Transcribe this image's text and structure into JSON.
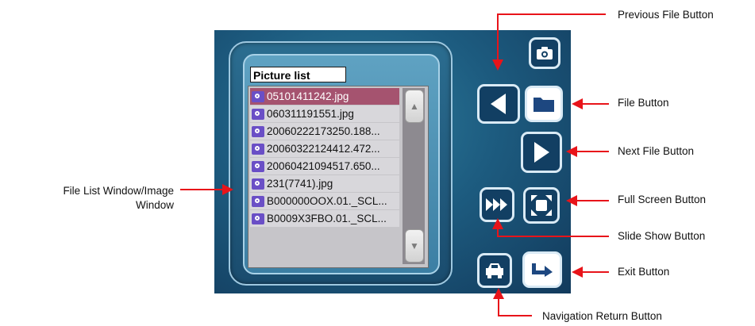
{
  "picture_list": {
    "title": "Picture list",
    "files": [
      "05101411242.jpg",
      "060311191551.jpg",
      "20060222173250.188...",
      "20060322124412.472...",
      "20060421094517.650...",
      "231(7741).jpg",
      "B000000OOX.01._SCL...",
      "B0009X3FBO.01._SCL..."
    ],
    "selected_index": 0
  },
  "callouts": {
    "previous_file": "Previous File Button",
    "file": "File Button",
    "next_file": "Next File Button",
    "full_screen": "Full Screen Button",
    "slide_show": "Slide Show Button",
    "exit": "Exit Button",
    "navigation_return": "Navigation Return Button",
    "file_list_line1": "File List Window/Image",
    "file_list_line2": "Window"
  },
  "colors": {
    "callout_red": "#e8141a",
    "selected_row": "#a5536f",
    "button_dark": "#123f63",
    "file_icon": "#6a4fc6"
  }
}
